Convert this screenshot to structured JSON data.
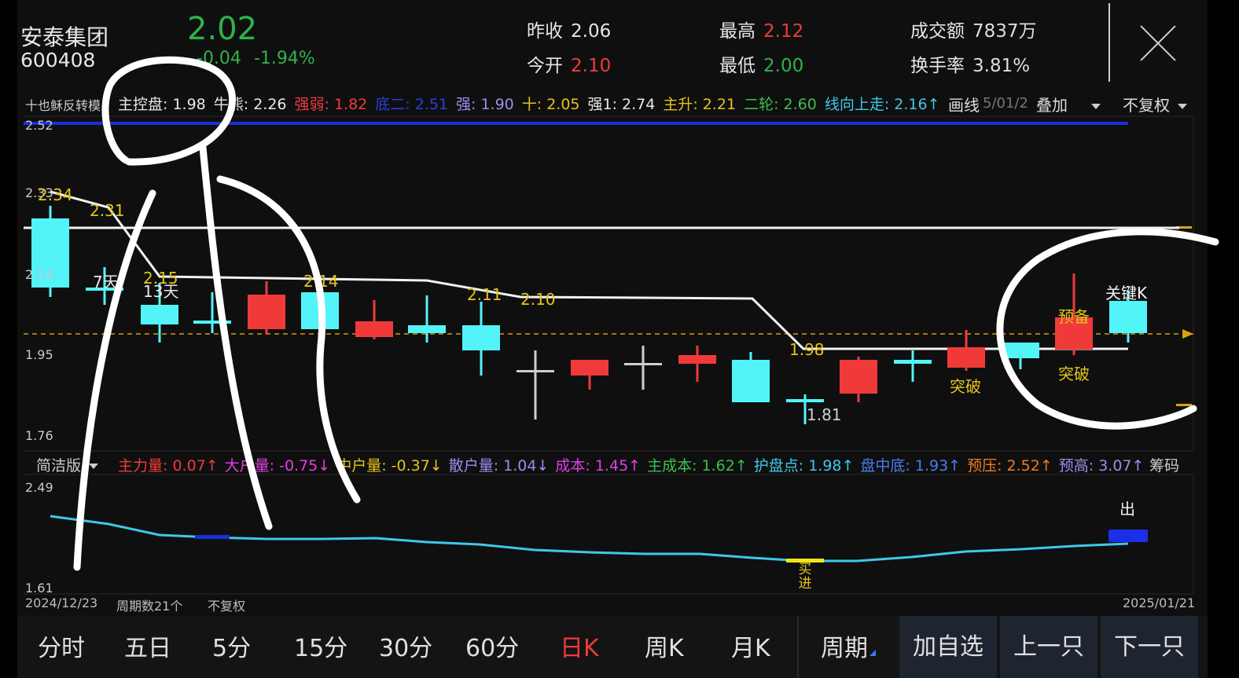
{
  "header": {
    "name": "安泰集团",
    "code": "600408",
    "price": "2.02",
    "change": "-0.04",
    "change_pct": "-1.94%",
    "quotes": [
      {
        "label": "昨收",
        "value": "2.06",
        "color": "#e6e6e6"
      },
      {
        "label": "今开",
        "value": "2.10",
        "color": "#f03a3a"
      },
      {
        "label": "最高",
        "value": "2.12",
        "color": "#f03a3a"
      },
      {
        "label": "最低",
        "value": "2.00",
        "color": "#2db34a"
      },
      {
        "label": "成交额",
        "value": "7837万",
        "color": "#e6e6e6"
      },
      {
        "label": "换手率",
        "value": "3.81%",
        "color": "#e6e6e6"
      }
    ]
  },
  "indicators_top": {
    "name": "十也稣反转模",
    "items": [
      {
        "text": "主控盘: 1.98",
        "color": "#e8e8e8"
      },
      {
        "text": "牛熊: 2.26",
        "color": "#e8e8e8"
      },
      {
        "text": "强弱: 1.82",
        "color": "#f03a3a"
      },
      {
        "text": "底二: 2.51",
        "color": "#2a3fe0"
      },
      {
        "text": "强: 1.90",
        "color": "#a08be8"
      },
      {
        "text": "十: 2.05",
        "color": "#e5c31a"
      },
      {
        "text": "强1: 2.74",
        "color": "#e8e8e8"
      },
      {
        "text": "主升: 2.21",
        "color": "#e5c31a"
      },
      {
        "text": "二轮: 2.60",
        "color": "#3cbf4a"
      },
      {
        "text": "线向上走: 2.16↑",
        "color": "#3fc8e8"
      }
    ],
    "draw_label": "画线",
    "date_partial": "5/01/2",
    "overlay_label": "叠加",
    "rights_label": "不复权"
  },
  "main_chart": {
    "y_ticks": [
      "2.52",
      "2.33",
      "2.14",
      "1.95",
      "1.76"
    ],
    "labels": [
      {
        "text": "2.34",
        "color": "#e5c31a"
      },
      {
        "text": "2.31",
        "color": "#e5c31a"
      },
      {
        "text": "7天",
        "color": "#e8e8e8"
      },
      {
        "text": "2.15",
        "color": "#e5c31a"
      },
      {
        "text": "13天",
        "color": "#e8e8e8"
      },
      {
        "text": "2.14",
        "color": "#e5c31a"
      },
      {
        "text": "2.11",
        "color": "#e5c31a"
      },
      {
        "text": "2.10",
        "color": "#e5c31a"
      },
      {
        "text": "1.98",
        "color": "#e5c31a"
      },
      {
        "text": "1.81",
        "color": "#cfcfcf"
      },
      {
        "text": "突破",
        "color": "#e5c31a"
      },
      {
        "text": "预备",
        "color": "#e5c31a"
      },
      {
        "text": "突破",
        "color": "#e5c31a"
      },
      {
        "text": "关键K",
        "color": "#f2f2f2"
      }
    ]
  },
  "sub_indicators": {
    "mode_label": "简洁版",
    "items": [
      {
        "text": "主力量: 0.07↑",
        "color": "#f03a3a"
      },
      {
        "text": "大户量: -0.75↓",
        "color": "#e040e0"
      },
      {
        "text": "中户量: -0.37↓",
        "color": "#e5c31a"
      },
      {
        "text": "散户量: 1.04↓",
        "color": "#a08be8"
      },
      {
        "text": "成本: 1.45↑",
        "color": "#e040e0"
      },
      {
        "text": "主成本: 1.62↑",
        "color": "#3cbf4a"
      },
      {
        "text": "护盘点: 1.98↑",
        "color": "#3fc8e8"
      },
      {
        "text": "盘中底: 1.93↑",
        "color": "#4a7ef0"
      },
      {
        "text": "预压: 2.52↑",
        "color": "#f07a20"
      },
      {
        "text": "预高: 3.07↑",
        "color": "#a08be8"
      }
    ],
    "chips_label": "筹码"
  },
  "sub_chart": {
    "y_ticks": [
      "2.49",
      "1.61"
    ],
    "buy_label": "买进",
    "sell_label": "出"
  },
  "footer": {
    "start_date": "2024/12/23",
    "period_count": "周期数21个",
    "rights": "不复权",
    "end_date": "2025/01/21"
  },
  "tabs": [
    "分时",
    "五日",
    "5分",
    "15分",
    "30分",
    "60分",
    "日K",
    "周K",
    "月K"
  ],
  "period_label": "周期",
  "actions": {
    "add": "加自选",
    "prev": "上一只",
    "next": "下一只"
  },
  "colors": {
    "up": "#f03a3a",
    "down": "#52f4f8",
    "flat": "#cfcfcf",
    "line": "#3fc8e8"
  }
}
